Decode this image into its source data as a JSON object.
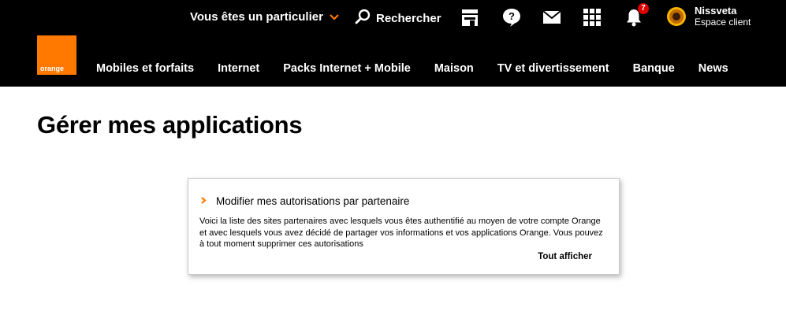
{
  "brand": {
    "logo_text": "orange",
    "accent_color": "#ff7900"
  },
  "top_bar": {
    "segment_label": "Vous êtes un particulier",
    "search_label": "Rechercher",
    "icons": [
      "store-icon",
      "help-icon",
      "mail-icon",
      "apps-grid-icon",
      "bell-icon"
    ],
    "notification_count": "7",
    "user": {
      "name": "Nissveta",
      "subtitle": "Espace client"
    }
  },
  "main_nav": {
    "items": [
      "Mobiles et forfaits",
      "Internet",
      "Packs Internet + Mobile",
      "Maison",
      "TV et divertissement",
      "Banque",
      "News"
    ]
  },
  "page": {
    "title": "Gérer mes applications"
  },
  "card": {
    "title": "Modifier mes autorisations par partenaire",
    "text": "Voici la liste des sites partenaires avec lesquels vous êtes authentifié au moyen de votre compte Orange et avec lesquels vous avez décidé de partager vos informations et vos applications Orange. Vous pouvez à tout moment supprimer ces autorisations",
    "link": "Tout afficher"
  }
}
